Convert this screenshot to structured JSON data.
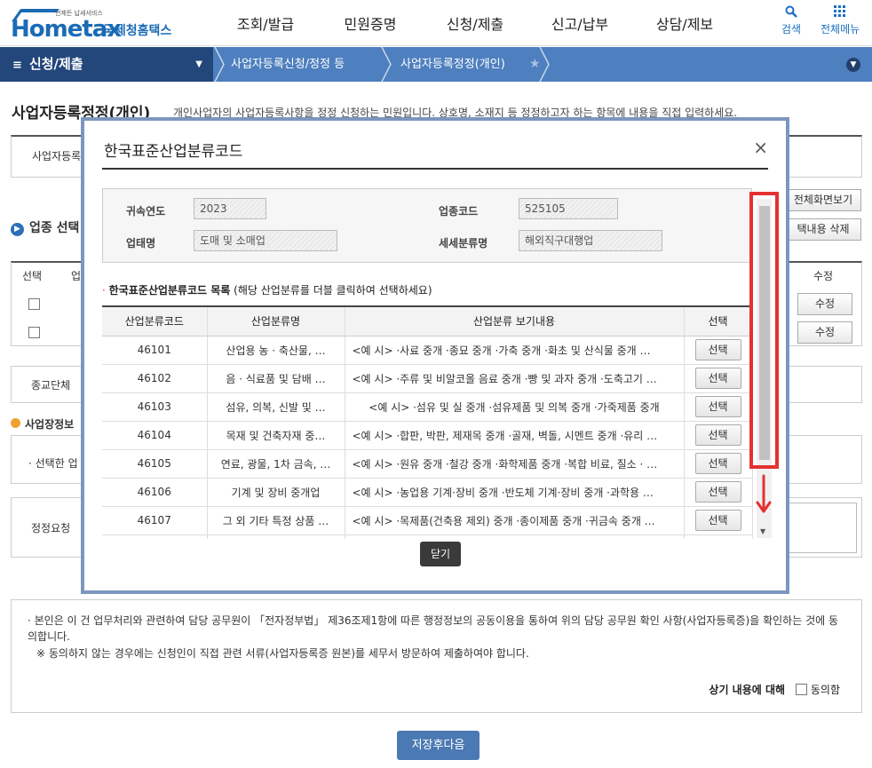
{
  "header": {
    "logo_main": "Hometax",
    "logo_small": "언제든 납세서비스",
    "logo_agency": "국세청홈택스",
    "gnb": [
      "조회/발급",
      "민원증명",
      "신청/제출",
      "신고/납부",
      "상담/제보"
    ],
    "search_label": "검색",
    "menu_label": "전체메뉴"
  },
  "navbar": {
    "current": "신청/제출",
    "crumb1": "사업자등록신청/정정 등",
    "crumb2": "사업자등록정정(개인)"
  },
  "page": {
    "title": "사업자등록정정(개인)",
    "description": "개인사업자의 사업자등록사항을 정정 신청하는 민원입니다. 상호명, 소재지 등 정정하고자 하는 항목에 내용을 직접 입력하세요.",
    "bg_label_business": "사업자등록",
    "industry_select": "업종 선택",
    "btn_full_view": "전체화면보기",
    "btn_delete_selected": "택내용 삭제",
    "col_select": "선택",
    "col_industry": "업",
    "col_edit": "수정",
    "edit_button": "수정",
    "religious_label": "종교단체",
    "site_info": "사업장정보",
    "selected_prefix": "선택한 업",
    "request_label": "정정요청",
    "consent_text1": "본인은 이 건 업무처리와 관련하여 담당 공무원이 「전자정부법」 제36조제1항에 따른 행정정보의 공동이용을 통하여 위의 담당 공무원 확인 사항(사업자등록증)을 확인하는 것에 동의합니다.",
    "consent_text2": "※ 동의하지 않는 경우에는 신청인이 직접 관련 서류(사업자등록증 원본)를 세무서 방문하여 제출하여야 합니다.",
    "consent_question": "상기 내용에 대해",
    "consent_agree": "동의함",
    "save_next": "저장후다음"
  },
  "modal": {
    "title": "한국표준산업분류코드",
    "close_x": "×",
    "info": {
      "year_label": "귀속연도",
      "year_value": "2023",
      "code_label": "업종코드",
      "code_value": "525105",
      "type_label": "업태명",
      "type_value": "도매 및 소매업",
      "detail_label": "세세분류명",
      "detail_value": "해외직구대행업"
    },
    "list_title_bold": "한국표준산업분류코드 목록",
    "list_title_note": "(해당 산업분류를 더블 클릭하여 선택하세요)",
    "columns": [
      "산업분류코드",
      "산업분류명",
      "산업분류 보기내용",
      "선택"
    ],
    "rows": [
      {
        "code": "46101",
        "name": "산업용 농 · 축산물, …",
        "detail": "<예 시> ·사료 중개 ·종묘 중개 ·가축 중개 ·화초 및 산식물 중개 …",
        "select": "선택"
      },
      {
        "code": "46102",
        "name": "음 · 식료품 및 담배 …",
        "detail": "<예 시> ·주류 및 비알코올 음료 중개 ·빵 및 과자 중개 ·도축고기 …",
        "select": "선택"
      },
      {
        "code": "46103",
        "name": "섬유, 의복, 신발 및 …",
        "detail": "<예 시> ·섬유 및 실 중개 ·섬유제품 및 의복 중개 ·가죽제품 중개",
        "select": "선택"
      },
      {
        "code": "46104",
        "name": "목재 및 건축자재 중…",
        "detail": "<예 시> ·합판, 박판, 제재목 중개 ·골재, 벽돌, 시멘트 중개 ·유리 …",
        "select": "선택"
      },
      {
        "code": "46105",
        "name": "연료, 광물, 1차 금속, …",
        "detail": "<예 시> ·원유 중개 ·철강 중개 ·화학제품 중개 ·복합 비료, 질소 · …",
        "select": "선택"
      },
      {
        "code": "46106",
        "name": "기계 및 장비 중개업",
        "detail": "<예 시> ·농업용 기계·장비 중개 ·반도체 기계·장비 중개 ·과학용 …",
        "select": "선택"
      },
      {
        "code": "46107",
        "name": "그 외 기타 특정 상품 …",
        "detail": "<예 시> ·목제품(건축용 제외) 중개 ·종이제품 중개 ·귀금속 중개 …",
        "select": "선택"
      }
    ],
    "close_button": "닫기"
  },
  "colors": {
    "navbar": "#4e7fbf",
    "navbar_dark": "#23467b",
    "brand": "#1b6bb5",
    "highlight": "#e53131",
    "modal_border": "#7c97bd"
  }
}
